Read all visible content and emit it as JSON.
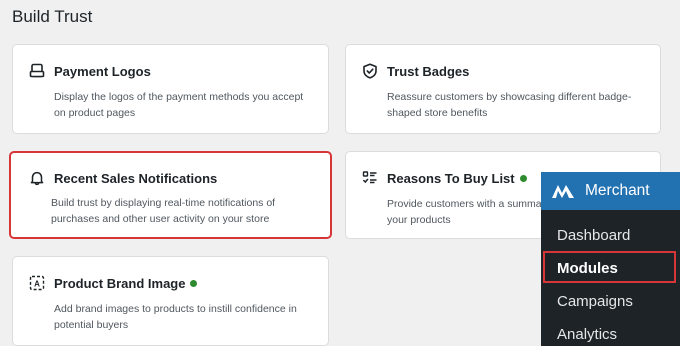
{
  "section": {
    "title": "Build Trust"
  },
  "cards": [
    {
      "title": "Payment Logos",
      "description": "Display the logos of the payment methods you accept on product pages",
      "icon": "payment-card-icon",
      "active": false
    },
    {
      "title": "Trust Badges",
      "description": "Reassure customers by showcasing different badge-shaped store benefits",
      "icon": "shield-check-icon",
      "active": false
    },
    {
      "title": "Recent Sales Notifications",
      "description": "Build trust by displaying real-time notifications of purchases and other user activity on your store",
      "icon": "bell-icon",
      "active": false,
      "highlighted": true
    },
    {
      "title": "Reasons To Buy List",
      "description": "Provide customers with a summary of the benefits of your products",
      "icon": "checklist-icon",
      "active": true
    },
    {
      "title": "Product Brand Image",
      "description": "Add brand images to products to instill confidence in potential buyers",
      "icon": "brand-image-icon",
      "active": true
    }
  ],
  "admin_menu": {
    "title": "Merchant",
    "items": [
      "Dashboard",
      "Modules",
      "Campaigns",
      "Analytics"
    ],
    "active_item": "Modules"
  },
  "colors": {
    "active_dot": "#2e8a2e",
    "highlight": "#d63638",
    "menu_header": "#2271b1",
    "menu_bg": "#1d2327"
  }
}
